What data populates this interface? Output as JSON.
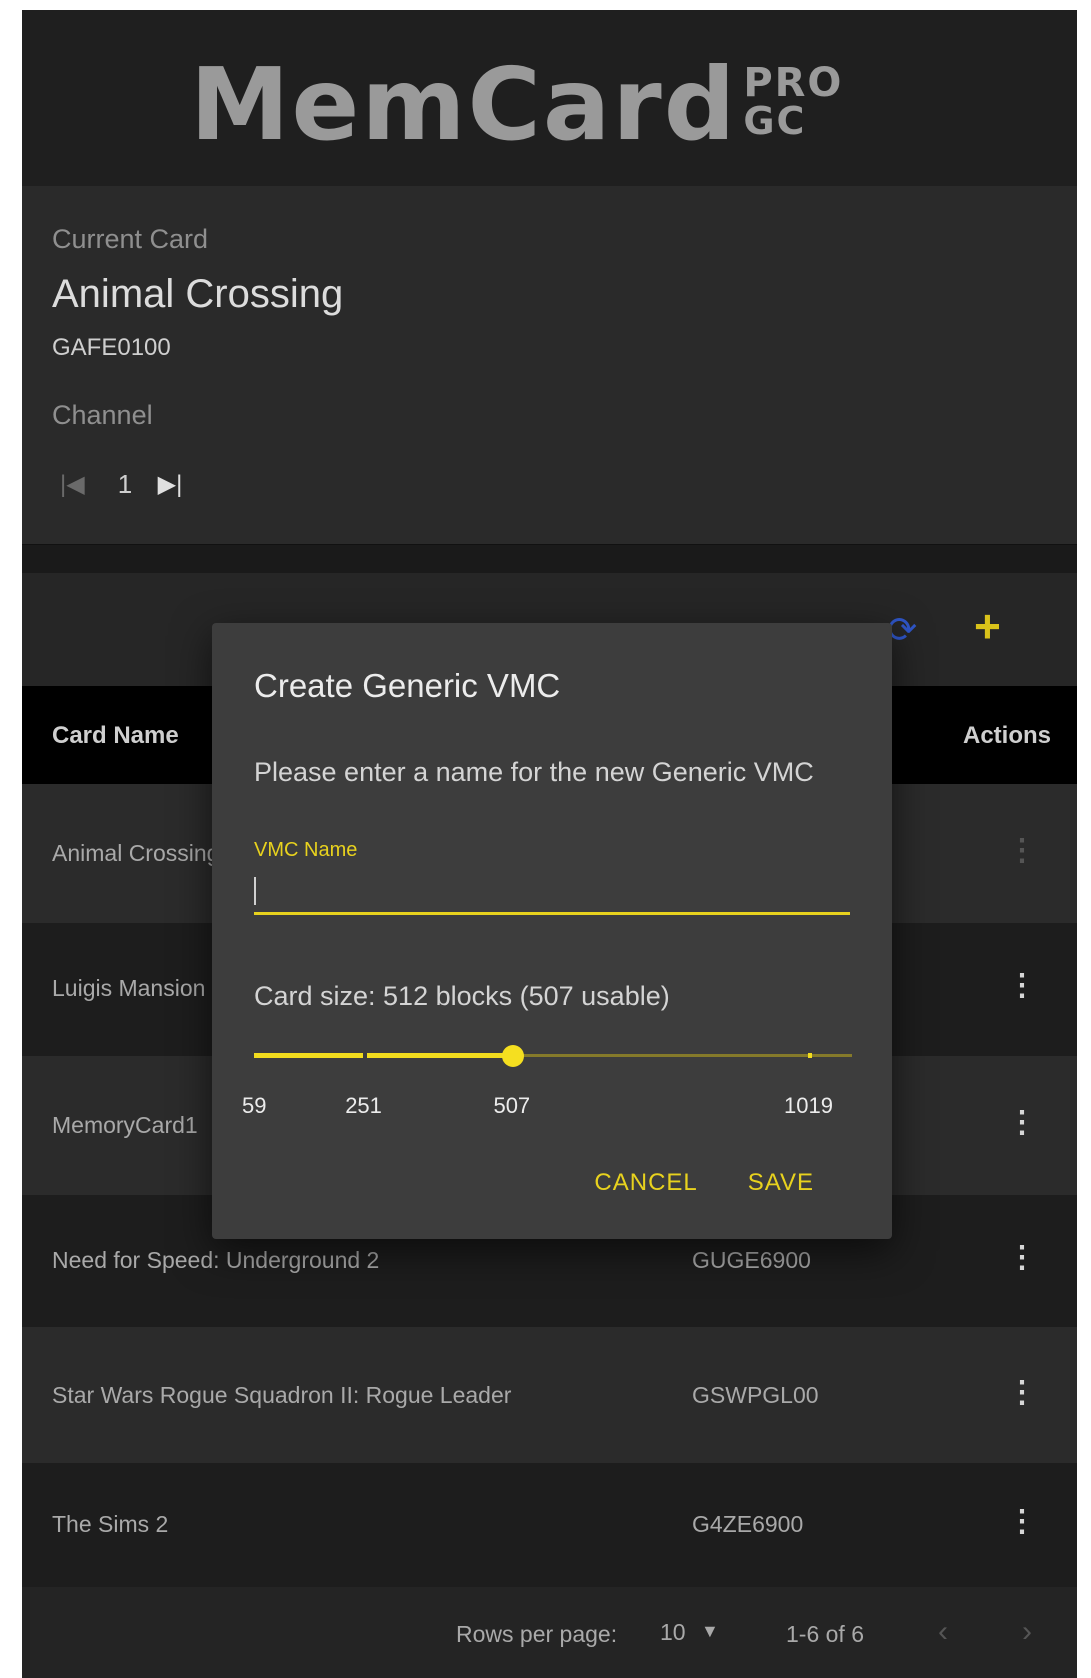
{
  "logo": {
    "main": "MemCard",
    "sup_top": "PRO",
    "sup_bottom": "GC"
  },
  "current_card": {
    "label": "Current Card",
    "name": "Animal Crossing",
    "code": "GAFE0100",
    "channel_label": "Channel",
    "channel_value": "1",
    "first_icon": "first-page-icon",
    "last_icon": "last-page-icon"
  },
  "toolbar": {
    "refresh_icon": "sync-icon",
    "add_icon": "plus-icon",
    "accent": "#d9c21a",
    "refresh_color": "#2f56c8"
  },
  "table": {
    "headers": {
      "name": "Card Name",
      "actions": "Actions"
    },
    "rows": [
      {
        "name": "Animal Crossing",
        "code": ""
      },
      {
        "name": "Luigis Mansion",
        "code": ""
      },
      {
        "name": "MemoryCard1",
        "code": ""
      },
      {
        "name": "Need for Speed: Underground 2",
        "code": "GUGE6900"
      },
      {
        "name": "Star Wars Rogue Squadron II: Rogue Leader",
        "code": "GSWPGL00"
      },
      {
        "name": "The Sims 2",
        "code": "G4ZE6900"
      }
    ],
    "menu_glyph": "⋮"
  },
  "footer": {
    "rows_per_page_label": "Rows per page:",
    "rows_per_page_value": "10",
    "range": "1-6 of 6"
  },
  "dialog": {
    "title": "Create Generic VMC",
    "description": "Please enter a name for the new Generic VMC",
    "field_label": "VMC Name",
    "field_value": "",
    "card_size": "Card size: 512 blocks (507 usable)",
    "slider": {
      "min": 59,
      "max": 1019,
      "value": 507,
      "marks": [
        59,
        251,
        507,
        1019
      ]
    },
    "mark_labels": [
      "59",
      "251",
      "507",
      "1019"
    ],
    "cancel": "CANCEL",
    "save": "SAVE",
    "accent": "#e8d21e"
  }
}
